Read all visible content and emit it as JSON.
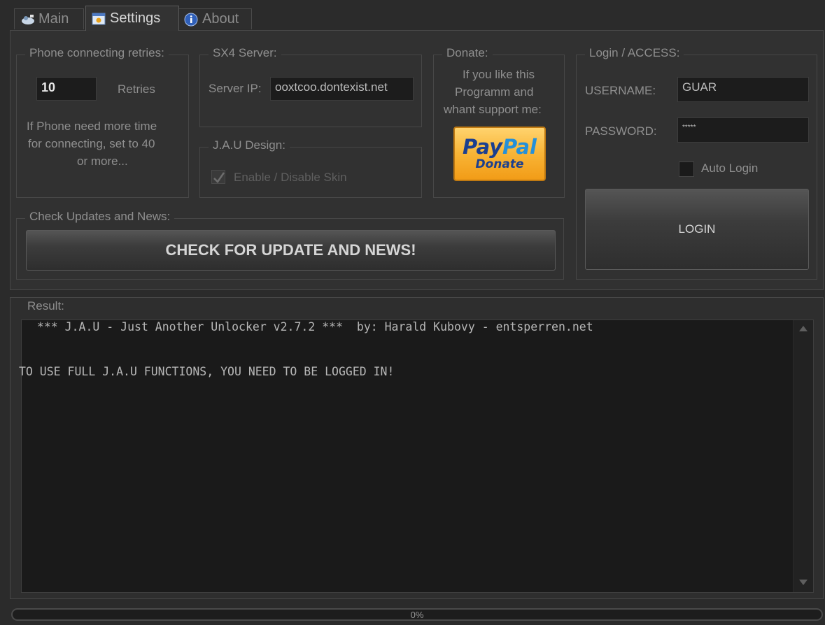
{
  "tabs": [
    {
      "label": "Main",
      "icon": "satellite-icon"
    },
    {
      "label": "Settings",
      "icon": "settings-icon"
    },
    {
      "label": "About",
      "icon": "info-icon"
    }
  ],
  "phone": {
    "title": "Phone connecting retries:",
    "retries_value": "10",
    "retries_label": "Retries",
    "note_line1": "If Phone  need more time",
    "note_line2": "for connecting, set to 40",
    "note_line3": "or more..."
  },
  "server": {
    "title": "SX4 Server:",
    "ip_label": "Server IP:",
    "ip_value": "ooxtcoo.dontexist.net"
  },
  "design": {
    "title": "J.A.U Design:",
    "checkbox_label": "Enable / Disable Skin",
    "checked": true
  },
  "donate": {
    "title": "Donate:",
    "line1": "If you like this",
    "line2": "Programm and",
    "line3": "whant support me:",
    "paypal_logo": "PayPal",
    "paypal_button": "Donate"
  },
  "login": {
    "title": "Login / ACCESS:",
    "username_label": "USERNAME:",
    "username_value": "GUAR",
    "password_label": "PASSWORD:",
    "password_value": "*****",
    "auto_login_label": "Auto Login",
    "login_button": "LOGIN"
  },
  "updates": {
    "title": "Check Updates and News:",
    "button": "CHECK FOR UPDATE AND NEWS!"
  },
  "result": {
    "title": "Result:",
    "line1": " *** J.A.U - Just Another Unlocker v2.7.2 ***  by: Harald Kubovy - entsperren.net",
    "line2": "TO USE FULL J.A.U FUNCTIONS, YOU NEED TO BE LOGGED IN!"
  },
  "progress": {
    "label": "0%",
    "value": 0
  },
  "colors": {
    "paypal_orange": "#f6a21c",
    "paypal_blue": "#1b3f8f"
  }
}
